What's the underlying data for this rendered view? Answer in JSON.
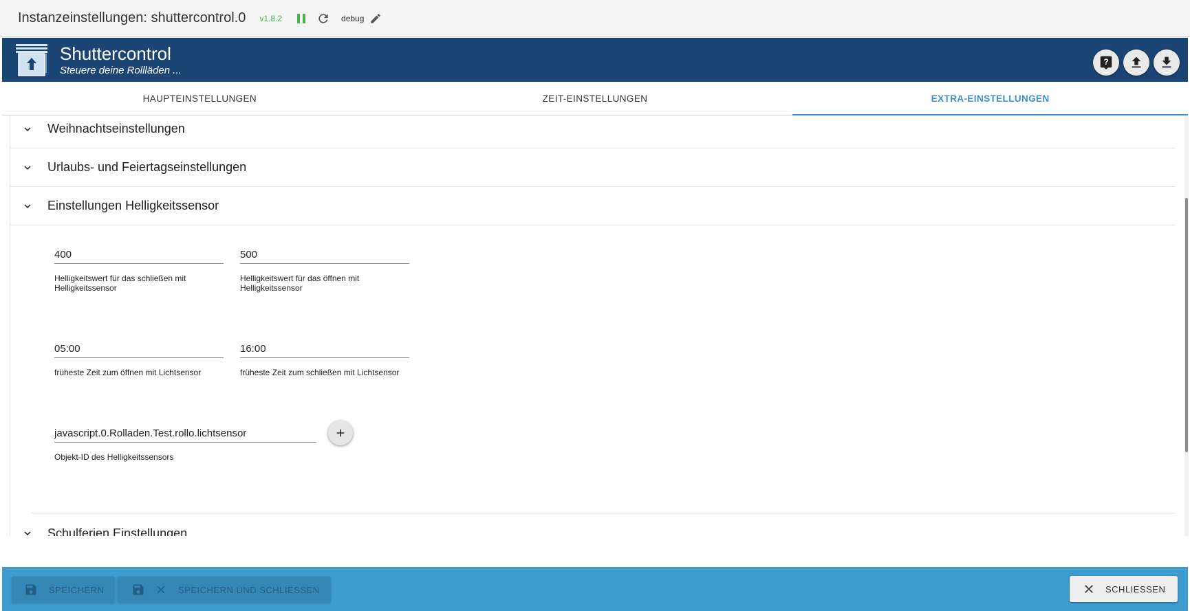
{
  "titlebar": {
    "title": "Instanzeinstellungen: shuttercontrol.0",
    "version": "v1.8.2",
    "log_level": "debug"
  },
  "banner": {
    "app_name": "Shuttercontrol",
    "subtitle": "Steuere deine Rollläden ..."
  },
  "tabs": [
    {
      "label": "HAUPTEINSTELLUNGEN",
      "active": false
    },
    {
      "label": "ZEIT-EINSTELLUNGEN",
      "active": false
    },
    {
      "label": "EXTRA-EINSTELLUNGEN",
      "active": true
    }
  ],
  "sections": {
    "christmas": {
      "label": "Weihnachtseinstellungen"
    },
    "holiday": {
      "label": "Urlaubs- und Feiertagseinstellungen"
    },
    "brightness": {
      "label": "Einstellungen Helligkeitssensor",
      "close_value": {
        "value": "400",
        "hint": "Helligkeitswert für das schließen mit Helligkeitssensor"
      },
      "open_value": {
        "value": "500",
        "hint": "Helligkeitswert für das öffnen mit Helligkeitssensor"
      },
      "open_time": {
        "value": "05:00",
        "hint": "früheste Zeit zum öffnen mit Lichtsensor"
      },
      "close_time": {
        "value": "16:00",
        "hint": "früheste Zeit zum schließen mit Lichtsensor"
      },
      "object_id": {
        "value": "javascript.0.Rolladen.Test.rollo.lichtsensor",
        "hint": "Objekt-ID des Helligkeitssensors"
      }
    },
    "school_holidays": {
      "label": "Schulferien Einstellungen"
    }
  },
  "footer": {
    "save_label": "SPEICHERN",
    "save_close_label": "SPEICHERN UND SCHLIESSEN",
    "close_label": "SCHLIESSEN"
  },
  "colors": {
    "banner": "#1b4574",
    "accent": "#3e8fc9",
    "footer": "#3e9ccf",
    "running": "#4caf50"
  },
  "icons": [
    "pause-icon",
    "reload-icon",
    "edit-icon",
    "shutter-logo-icon",
    "help-icon",
    "upload-icon",
    "download-icon",
    "chevron-down-icon",
    "add-icon",
    "save-icon",
    "close-icon"
  ]
}
